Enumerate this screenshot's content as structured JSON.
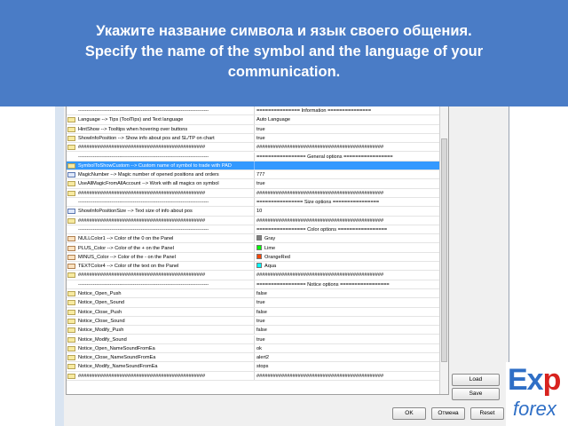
{
  "banner": {
    "line1": "Укажите название символа и язык своего общения.",
    "line2": "Specify the name of the symbol and the language of your",
    "line3": "communication."
  },
  "params": [
    {
      "icon": "none",
      "name": "-------------------------------------------------------------------------------",
      "value": "=============== Information ==============="
    },
    {
      "icon": "ab",
      "name": "Language  --> Tips (ToolTips) and Text language",
      "value": "Auto Language"
    },
    {
      "icon": "ab",
      "name": "HintShow --> Tooltips when hovering over buttons",
      "value": "true"
    },
    {
      "icon": "ab",
      "name": "ShowInfoPosition --> Show info about pos and SL/TP on chart",
      "value": "true"
    },
    {
      "icon": "ab",
      "name": "##############################################",
      "value": "##############################################"
    },
    {
      "icon": "none",
      "name": "-------------------------------------------------------------------------------",
      "value": "================= General options ================="
    },
    {
      "icon": "ab",
      "name": "SymbolToShowCustom --> Custom name of symbol to trade with PAD",
      "value": "",
      "selected": true
    },
    {
      "icon": "num",
      "name": "MagicNumber --> Magic number of opened positions and orders",
      "value": "777"
    },
    {
      "icon": "ab",
      "name": "UseAllMagicFromAllAccount --> Work with all magics on symbol",
      "value": "true"
    },
    {
      "icon": "ab",
      "name": "##############################################",
      "value": "##############################################"
    },
    {
      "icon": "none",
      "name": "-------------------------------------------------------------------------------",
      "value": "================ Size options ================"
    },
    {
      "icon": "num",
      "name": "ShowInfoPositionSize --> Text size of info about pos",
      "value": "10"
    },
    {
      "icon": "ab",
      "name": "##############################################",
      "value": "##############################################"
    },
    {
      "icon": "none",
      "name": "-------------------------------------------------------------------------------",
      "value": "================= Color options ================="
    },
    {
      "icon": "col",
      "name": "NULLColor1 --> Color of the 0 on the Panel",
      "value": "Gray",
      "swatch": "#808080"
    },
    {
      "icon": "col",
      "name": "PLUS_Color --> Color of the + on the Panel",
      "value": "Lime",
      "swatch": "#00ff00"
    },
    {
      "icon": "col",
      "name": "MINUS_Color --> Color of the - on the Panel",
      "value": "OrangeRed",
      "swatch": "#ff4500"
    },
    {
      "icon": "col",
      "name": "TEXTColor4 --> Color of the text on the Panel",
      "value": "Aqua",
      "swatch": "#00ffff"
    },
    {
      "icon": "ab",
      "name": "##############################################",
      "value": "##############################################"
    },
    {
      "icon": "none",
      "name": "-------------------------------------------------------------------------------",
      "value": "================= Notice options ================="
    },
    {
      "icon": "ab",
      "name": "Notice_Open_Push",
      "value": "false"
    },
    {
      "icon": "ab",
      "name": "Notice_Open_Sound",
      "value": "true"
    },
    {
      "icon": "ab",
      "name": "Notice_Close_Push",
      "value": "false"
    },
    {
      "icon": "ab",
      "name": "Notice_Close_Sound",
      "value": "true"
    },
    {
      "icon": "ab",
      "name": "Notice_Modify_Push",
      "value": "false"
    },
    {
      "icon": "ab",
      "name": "Notice_Modify_Sound",
      "value": "true"
    },
    {
      "icon": "ab",
      "name": "Notice_Open_NameSoundFromEa",
      "value": "ok"
    },
    {
      "icon": "ab",
      "name": "Notice_Close_NameSoundFromEa",
      "value": "alert2"
    },
    {
      "icon": "ab",
      "name": "Notice_Modify_NameSoundFromEa",
      "value": "stops"
    },
    {
      "icon": "ab",
      "name": "##############################################",
      "value": "##############################################"
    }
  ],
  "buttons": {
    "load": "Load",
    "save": "Save",
    "ok": "OK",
    "cancel": "Отмена",
    "reset": "Reset"
  },
  "logo": {
    "exp_e": "Ex",
    "exp_p": "p",
    "forex": "forex"
  },
  "colors": {
    "banner": "#4a7cc6",
    "selection": "#3399ff",
    "logo_blue": "#2f6fc6",
    "logo_red": "#d8231f"
  }
}
